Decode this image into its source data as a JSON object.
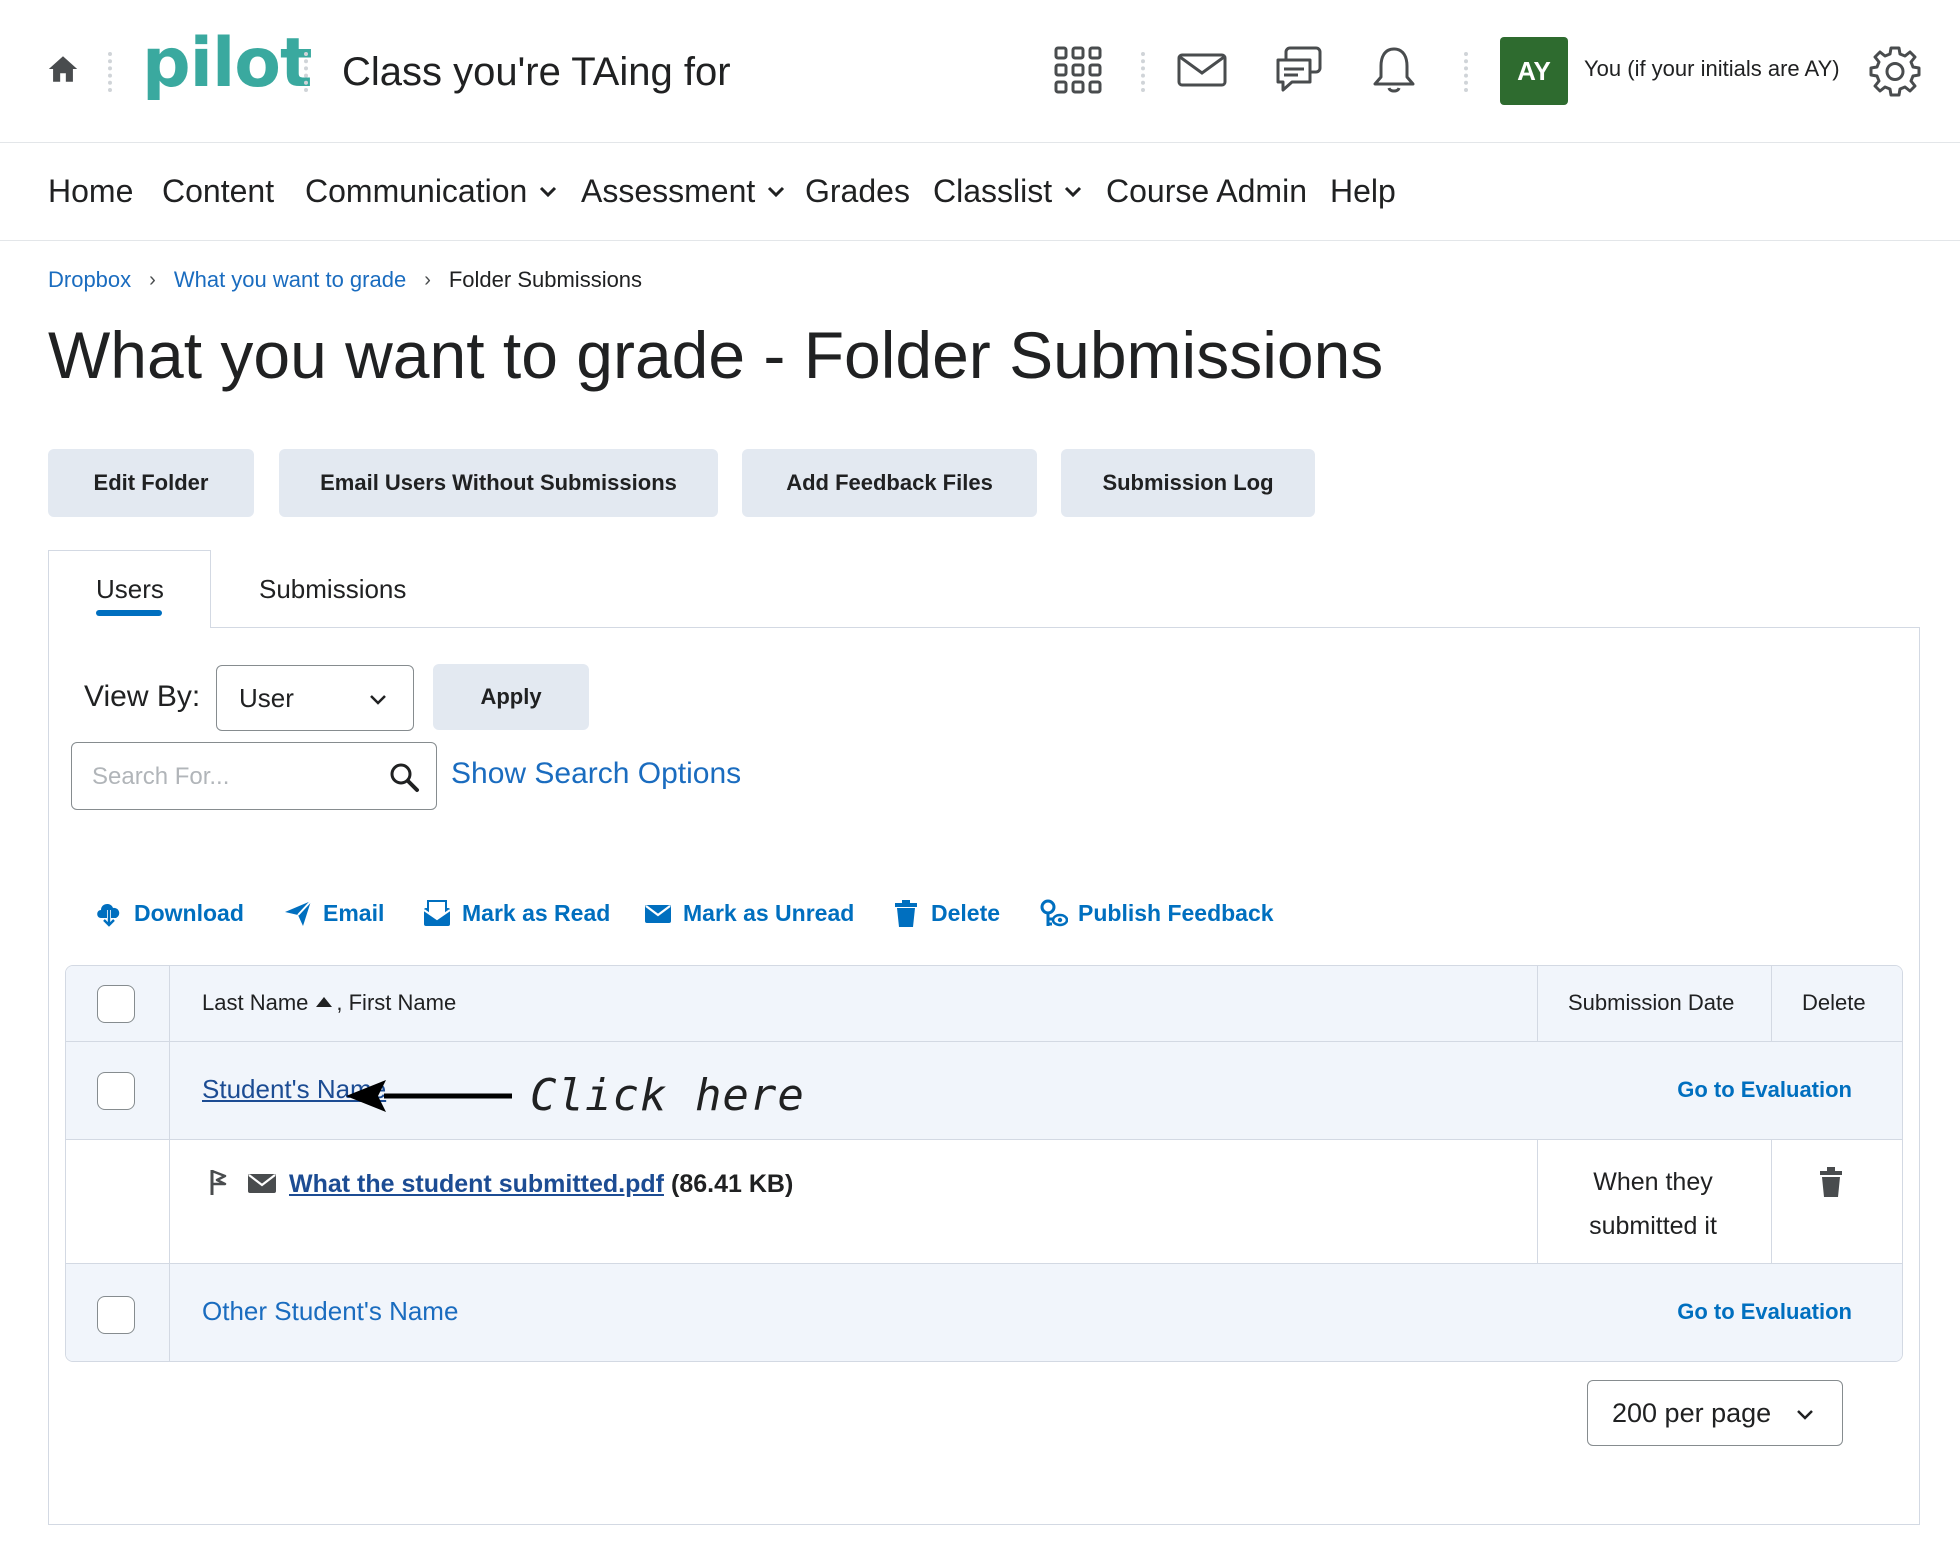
{
  "header": {
    "logo": "pilot",
    "course_title": "Class you're TAing for",
    "avatar_initials": "AY",
    "user_name": "You (if your initials are AY)",
    "icons": [
      "home-icon",
      "waffle-grid-icon",
      "mail-icon",
      "chat-icon",
      "bell-icon",
      "gear-icon"
    ]
  },
  "nav": {
    "items": [
      {
        "label": "Home",
        "has_menu": false
      },
      {
        "label": "Content",
        "has_menu": false
      },
      {
        "label": "Communication",
        "has_menu": true
      },
      {
        "label": "Assessment",
        "has_menu": true
      },
      {
        "label": "Grades",
        "has_menu": false
      },
      {
        "label": "Classlist",
        "has_menu": true
      },
      {
        "label": "Course Admin",
        "has_menu": false
      },
      {
        "label": "Help",
        "has_menu": false
      }
    ]
  },
  "breadcrumb": {
    "items": [
      "Dropbox",
      "What you want to grade"
    ],
    "current": "Folder Submissions"
  },
  "page_title": "What you want to grade - Folder Submissions",
  "toolbar": {
    "buttons": [
      "Edit Folder",
      "Email Users Without Submissions",
      "Add Feedback Files",
      "Submission Log"
    ]
  },
  "tabs": {
    "items": [
      "Users",
      "Submissions"
    ],
    "active": "Users"
  },
  "filters": {
    "view_by_label": "View By:",
    "view_by_value": "User",
    "apply_label": "Apply",
    "search_placeholder": "Search For...",
    "search_options_label": "Show Search Options"
  },
  "actions": {
    "items": [
      "Download",
      "Email",
      "Mark as Read",
      "Mark as Unread",
      "Delete",
      "Publish Feedback"
    ]
  },
  "table": {
    "headers": {
      "name_last": "Last Name",
      "name_first": ", First Name",
      "submission_date": "Submission Date",
      "delete": "Delete"
    },
    "rows": [
      {
        "student": "Student's Name",
        "action": "Go to Evaluation",
        "file": {
          "name": "What the student submitted.pdf",
          "size": "(86.41 KB)",
          "date_line1": "When they",
          "date_line2": "submitted it"
        }
      },
      {
        "student": "Other Student's Name",
        "action": "Go to Evaluation"
      }
    ]
  },
  "annotation": {
    "text": "Click here"
  },
  "pagination": {
    "per_page": "200 per page"
  },
  "colors": {
    "brand_teal": "#3aa99f",
    "link_blue": "#006fbf",
    "avatar_green": "#2e6b2f",
    "button_bg": "#e3e9f1",
    "row_bg": "#f1f5fb"
  }
}
